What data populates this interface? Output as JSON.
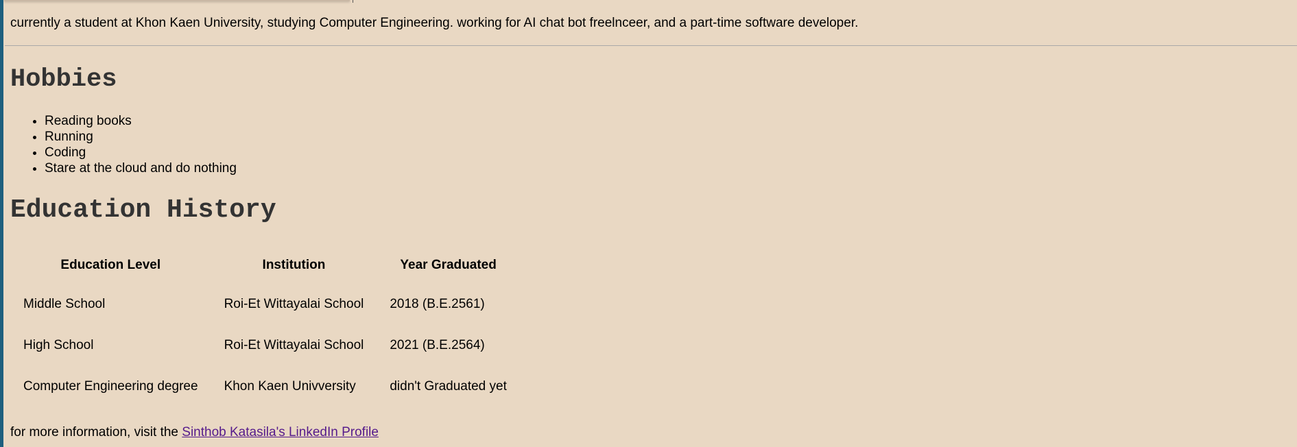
{
  "intro": {
    "text": "currently a student at Khon Kaen University, studying Computer Engineering. working for AI chat bot freelnceer, and a part-time software developer."
  },
  "hobbies": {
    "heading": "Hobbies",
    "items": [
      "Reading books",
      "Running",
      "Coding",
      "Stare at the cloud and do nothing"
    ]
  },
  "education": {
    "heading": "Education History",
    "columns": [
      "Education Level",
      "Institution",
      "Year Graduated"
    ],
    "rows": [
      [
        "Middle School",
        "Roi-Et Wittayalai School",
        "2018 (B.E.2561)"
      ],
      [
        "High School",
        "Roi-Et Wittayalai School",
        "2021 (B.E.2564)"
      ],
      [
        "Computer Engineering degree",
        "Khon Kaen Univversity",
        "didn't Graduated yet"
      ]
    ]
  },
  "footer": {
    "prefix": "for more information, visit the ",
    "link_text": "Sinthob Katasila's LinkedIn Profile"
  },
  "colors": {
    "background": "#e9d8c3",
    "heading": "#333333",
    "link": "#551a8b",
    "left_bar": "#1e5f7e"
  }
}
